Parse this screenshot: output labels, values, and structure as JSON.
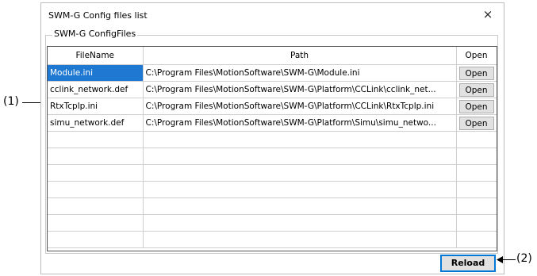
{
  "dialog": {
    "title": "SWM-G Config files list",
    "close_glyph": "×"
  },
  "group": {
    "label": "SWM-G ConfigFiles"
  },
  "table": {
    "headers": {
      "filename": "FileName",
      "path": "Path",
      "open": "Open"
    },
    "rows": [
      {
        "filename": "Module.ini",
        "path": "C:\\Program Files\\MotionSoftware\\SWM-G\\Module.ini",
        "open": "Open",
        "selected": true
      },
      {
        "filename": "cclink_network.def",
        "path": "C:\\Program Files\\MotionSoftware\\SWM-G\\Platform\\CCLink\\cclink_net...",
        "open": "Open"
      },
      {
        "filename": "RtxTcplp.ini",
        "path": "C:\\Program Files\\MotionSoftware\\SWM-G\\Platform\\CCLink\\RtxTcplp.ini",
        "open": "Open"
      },
      {
        "filename": "simu_network.def",
        "path": "C:\\Program Files\\MotionSoftware\\SWM-G\\Platform\\Simu\\simu_netwo...",
        "open": "Open"
      }
    ],
    "empty_row_count": 7
  },
  "reload_label": "Reload",
  "callouts": {
    "one": "(1)",
    "two": "(2)"
  },
  "colors": {
    "selection": "#1f78d1",
    "focus_border": "#0078d7"
  }
}
